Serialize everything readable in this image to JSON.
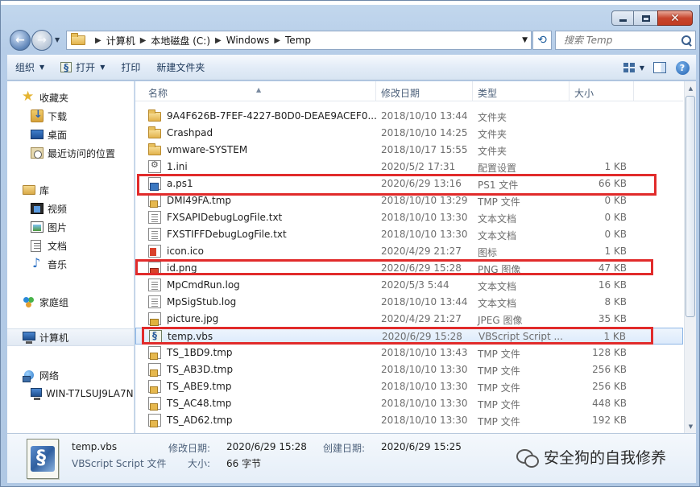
{
  "window": {
    "caption_close": "✕"
  },
  "address_bar": {
    "crumbs": [
      "计算机",
      "本地磁盘 (C:)",
      "Windows",
      "Temp"
    ]
  },
  "search": {
    "placeholder": "搜索 Temp"
  },
  "toolbar": {
    "organize": "组织",
    "open": "打开",
    "print": "打印",
    "new_folder": "新建文件夹"
  },
  "nav_pane": {
    "favorites": "收藏夹",
    "downloads": "下载",
    "desktop": "桌面",
    "recent": "最近访问的位置",
    "libraries": "库",
    "videos": "视频",
    "pictures": "图片",
    "documents": "文档",
    "music": "音乐",
    "homegroup": "家庭组",
    "computer": "计算机",
    "network": "网络",
    "network_host": "WIN-T7LSUJ9LA7N"
  },
  "columns": {
    "name": "名称",
    "modified": "修改日期",
    "type": "类型",
    "size": "大小"
  },
  "files": [
    {
      "name": "9A4F626B-7FEF-4227-B0D0-DEAE9ACEF0...",
      "date": "2018/10/10 13:44",
      "type": "文件夹",
      "size": "",
      "icon": "folder"
    },
    {
      "name": "Crashpad",
      "date": "2018/10/10 14:25",
      "type": "文件夹",
      "size": "",
      "icon": "folder"
    },
    {
      "name": "vmware-SYSTEM",
      "date": "2018/10/17 15:55",
      "type": "文件夹",
      "size": "",
      "icon": "folder"
    },
    {
      "name": "1.ini",
      "date": "2020/5/2 17:31",
      "type": "配置设置",
      "size": "1 KB",
      "icon": "ini"
    },
    {
      "name": "a.ps1",
      "date": "2020/6/29 13:16",
      "type": "PS1 文件",
      "size": "66 KB",
      "icon": "ps1"
    },
    {
      "name": "DMI49FA.tmp",
      "date": "2018/10/10 13:29",
      "type": "TMP 文件",
      "size": "0 KB",
      "icon": "tmp"
    },
    {
      "name": "FXSAPIDebugLogFile.txt",
      "date": "2018/10/10 13:30",
      "type": "文本文档",
      "size": "0 KB",
      "icon": "txt"
    },
    {
      "name": "FXSTIFFDebugLogFile.txt",
      "date": "2018/10/10 13:30",
      "type": "文本文档",
      "size": "0 KB",
      "icon": "txt"
    },
    {
      "name": "icon.ico",
      "date": "2020/4/29 21:27",
      "type": "图标",
      "size": "1 KB",
      "icon": "ico"
    },
    {
      "name": "id.png",
      "date": "2020/6/29 15:28",
      "type": "PNG 图像",
      "size": "47 KB",
      "icon": "png"
    },
    {
      "name": "MpCmdRun.log",
      "date": "2020/5/3 5:44",
      "type": "文本文档",
      "size": "16 KB",
      "icon": "txt"
    },
    {
      "name": "MpSigStub.log",
      "date": "2018/10/10 13:44",
      "type": "文本文档",
      "size": "8 KB",
      "icon": "txt"
    },
    {
      "name": "picture.jpg",
      "date": "2020/4/29 21:27",
      "type": "JPEG 图像",
      "size": "35 KB",
      "icon": "jpg"
    },
    {
      "name": "temp.vbs",
      "date": "2020/6/29 15:28",
      "type": "VBScript Script ...",
      "size": "1 KB",
      "icon": "vbs"
    },
    {
      "name": "TS_1BD9.tmp",
      "date": "2018/10/10 13:43",
      "type": "TMP 文件",
      "size": "128 KB",
      "icon": "tmp"
    },
    {
      "name": "TS_AB3D.tmp",
      "date": "2018/10/10 13:30",
      "type": "TMP 文件",
      "size": "256 KB",
      "icon": "tmp"
    },
    {
      "name": "TS_ABE9.tmp",
      "date": "2018/10/10 13:30",
      "type": "TMP 文件",
      "size": "256 KB",
      "icon": "tmp"
    },
    {
      "name": "TS_AC48.tmp",
      "date": "2018/10/10 13:30",
      "type": "TMP 文件",
      "size": "448 KB",
      "icon": "tmp"
    },
    {
      "name": "TS_AD62.tmp",
      "date": "2018/10/10 13:30",
      "type": "TMP 文件",
      "size": "192 KB",
      "icon": "tmp"
    }
  ],
  "details": {
    "name": "temp.vbs",
    "type": "VBScript Script 文件",
    "modified_label": "修改日期:",
    "modified_value": "2020/6/29 15:28",
    "created_label": "创建日期:",
    "created_value": "2020/6/29 15:25",
    "size_label": "大小:",
    "size_value": "66 字节"
  },
  "watermark": {
    "text": "安全狗的自我修养"
  },
  "colors": {
    "highlight": "#e12b2b",
    "selection": "#dceafb"
  }
}
